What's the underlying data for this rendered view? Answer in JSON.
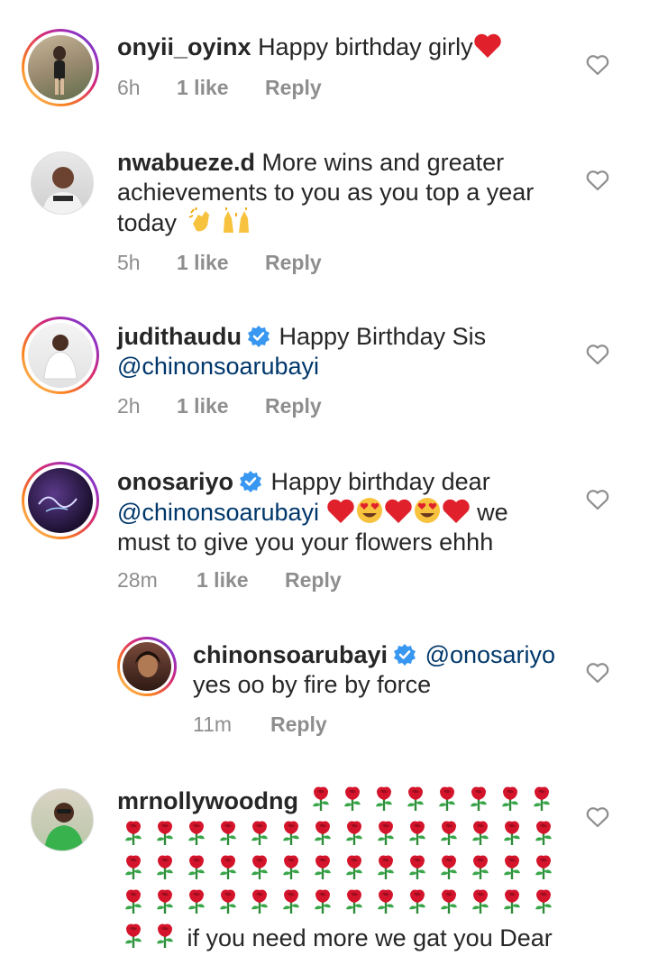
{
  "comments": [
    {
      "username": "onyii_oyinx",
      "text": "Happy birthday girly",
      "time": "6h",
      "likes": "1 like",
      "reply": "Reply",
      "avatar_icon": "user-photo-icon"
    },
    {
      "username": "nwabueze.d",
      "text_line1": "More wins and greater",
      "text_line2": "achievements to you as you top a year",
      "text_line3": "today",
      "time": "5h",
      "likes": "1 like",
      "reply": "Reply",
      "avatar_icon": "user-photo-icon"
    },
    {
      "username": "judithaudu",
      "text": "Happy Birthday Sis",
      "mention": "@chinonsoarubayi",
      "time": "2h",
      "likes": "1 like",
      "reply": "Reply",
      "avatar_icon": "user-photo-icon"
    },
    {
      "username": "onosariyo",
      "text_line1": "Happy birthday dear",
      "mention": "@chinonsoarubayi",
      "text_after_emoji": "we",
      "text_line3": "must to give you your flowers ehhh",
      "time": "28m",
      "likes": "1 like",
      "reply": "Reply",
      "avatar_icon": "user-photo-icon"
    },
    {
      "username": "chinonsoarubayi",
      "mention": "@onosariyo",
      "text": "yes oo by fire by force",
      "time": "11m",
      "reply": "Reply",
      "avatar_icon": "user-photo-icon"
    },
    {
      "username": "mrnollywoodng",
      "text_end": "if you need more we gat you Dear",
      "avatar_icon": "user-photo-icon"
    }
  ],
  "icons": {
    "like": "heart-outline-icon",
    "verified": "verified-badge-icon",
    "red_heart": "red-heart-icon",
    "heart_eyes": "heart-eyes-emoji-icon",
    "clap": "clapping-hands-icon",
    "raised_hands": "raising-hands-icon",
    "rose": "rose-icon"
  },
  "colors": {
    "text": "#262626",
    "secondary": "#8e8e8e",
    "mention": "#00376b",
    "verified": "#3897f0",
    "heart_red": "#e0212b"
  }
}
